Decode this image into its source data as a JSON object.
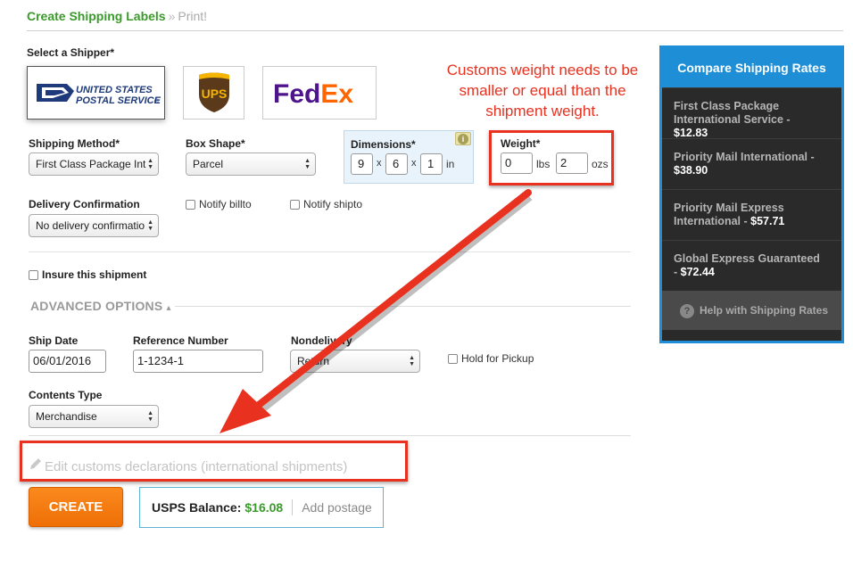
{
  "breadcrumb": {
    "step1": "Create Shipping Labels",
    "separator": "»",
    "step2": "Print!"
  },
  "shipper": {
    "label": "Select a Shipper*",
    "carriers": [
      {
        "name": "usps",
        "line1": "UNITED STATES",
        "line2": "POSTAL SERVICE",
        "mark": "®",
        "selected": true
      },
      {
        "name": "ups",
        "text": "UPS"
      },
      {
        "name": "fedex",
        "fed": "Fed",
        "ex": "Ex"
      }
    ]
  },
  "shipping_method": {
    "label": "Shipping Method*",
    "value": "First Class Package Int"
  },
  "box_shape": {
    "label": "Box Shape*",
    "value": "Parcel"
  },
  "dimensions": {
    "label": "Dimensions*",
    "length": "9",
    "width": "6",
    "height": "1",
    "x": "x",
    "unit": "in",
    "info": "i"
  },
  "weight": {
    "label": "Weight*",
    "lbs": "0",
    "lbs_unit": "lbs",
    "ozs": "2",
    "ozs_unit": "ozs"
  },
  "annotation": {
    "line1": "Customs weight needs to be",
    "line2": "smaller or equal than the",
    "line3": "shipment weight."
  },
  "delivery_confirmation": {
    "label": "Delivery Confirmation",
    "value": "No delivery confirmatio"
  },
  "notify": {
    "billto": "Notify billto",
    "shipto": "Notify shipto"
  },
  "insure": {
    "label": "Insure this shipment"
  },
  "advanced": {
    "label": "ADVANCED OPTIONS",
    "caret": "▴"
  },
  "ship_date": {
    "label": "Ship Date",
    "value": "06/01/2016"
  },
  "reference": {
    "label": "Reference Number",
    "value": "1-1234-1"
  },
  "nondelivery": {
    "label": "Nondelivery",
    "value": "Return"
  },
  "hold_pickup": {
    "label": "Hold for Pickup"
  },
  "contents_type": {
    "label": "Contents Type",
    "value": "Merchandise"
  },
  "customs": {
    "label": "Edit customs declarations (international shipments)"
  },
  "create_button": "CREATE",
  "balance": {
    "label": "USPS Balance:",
    "value": "$16.08",
    "add": "Add postage"
  },
  "rates": {
    "title": "Compare Shipping Rates",
    "items": [
      {
        "l1": "First Class Package",
        "l2": "International Service -",
        "price": "$12.83"
      },
      {
        "l1": "Priority Mail International -",
        "l2": "",
        "price": "$38.90"
      },
      {
        "l1": "Priority Mail Express",
        "l2": "International -",
        "price": "$57.71"
      },
      {
        "l1": "Global Express Guaranteed",
        "l2": "-",
        "price": "$72.44"
      }
    ],
    "help": "Help with Shipping Rates",
    "help_icon": "?"
  },
  "colors": {
    "accent_green": "#3a9a2a",
    "create_orange": "#f47c12",
    "annotation_red": "#e8311f",
    "rates_blue": "#1e8fd6"
  }
}
